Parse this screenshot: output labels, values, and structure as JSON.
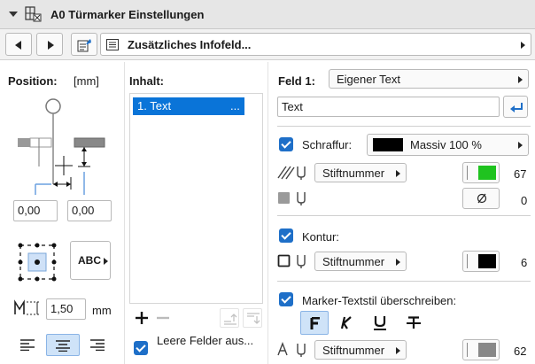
{
  "title": "A0 Türmarker Einstellungen",
  "toolbar": {
    "infofeld_label": "Zusätzliches Infofeld..."
  },
  "left": {
    "position_label": "Position:",
    "unit_label": "[mm]",
    "offset_x": "0,00",
    "offset_y": "0,00",
    "size_value": "1,50",
    "size_unit": "mm",
    "abc_label": "ABC"
  },
  "content": {
    "label": "Inhalt:",
    "items": [
      {
        "text": "1. Text",
        "more": "..."
      }
    ],
    "empty_fields_label": "Leere Felder aus..."
  },
  "right": {
    "field_label": "Feld 1:",
    "field_type": "Eigener Text",
    "text_value": "Text",
    "hatch": {
      "label": "Schraffur:",
      "fill_name": "Massiv 100 %",
      "pen_label": "Stiftnummer",
      "pen_value": "67",
      "bg_pen_value": "0",
      "fill_color": "#000000",
      "pen_color": "#1fc31f"
    },
    "contour": {
      "label": "Kontur:",
      "pen_label": "Stiftnummer",
      "pen_value": "6",
      "pen_color": "#000000"
    },
    "marker_text": {
      "label": "Marker-Textstil überschreiben:",
      "pen_label": "Stiftnummer",
      "pen_value": "62",
      "pen_color": "#888888"
    }
  }
}
